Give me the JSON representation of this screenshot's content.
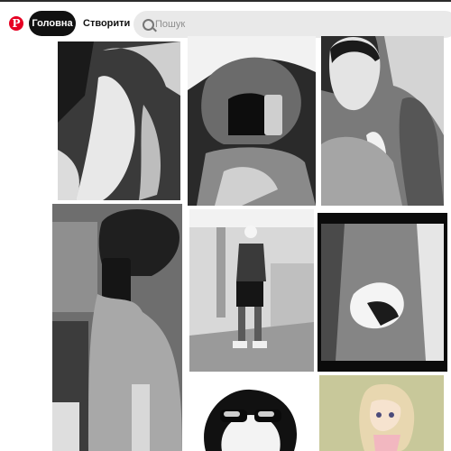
{
  "header": {
    "logo_letter": "P",
    "nav_home_label": "Головна",
    "nav_create_label": "Створити",
    "search_placeholder": "Пошук"
  },
  "pins": [
    {
      "icon": "photo-pin-hand-gesture"
    },
    {
      "icon": "photo-pin-hooded-figure"
    },
    {
      "icon": "photo-pin-car-selfie"
    },
    {
      "icon": "photo-pin-mirror-selfie"
    },
    {
      "icon": "photo-pin-man-standing-room"
    },
    {
      "icon": "photo-pin-lying-hallway"
    },
    {
      "icon": "photo-pin-sunglasses-face"
    },
    {
      "icon": "photo-pin-anime-figure"
    }
  ]
}
